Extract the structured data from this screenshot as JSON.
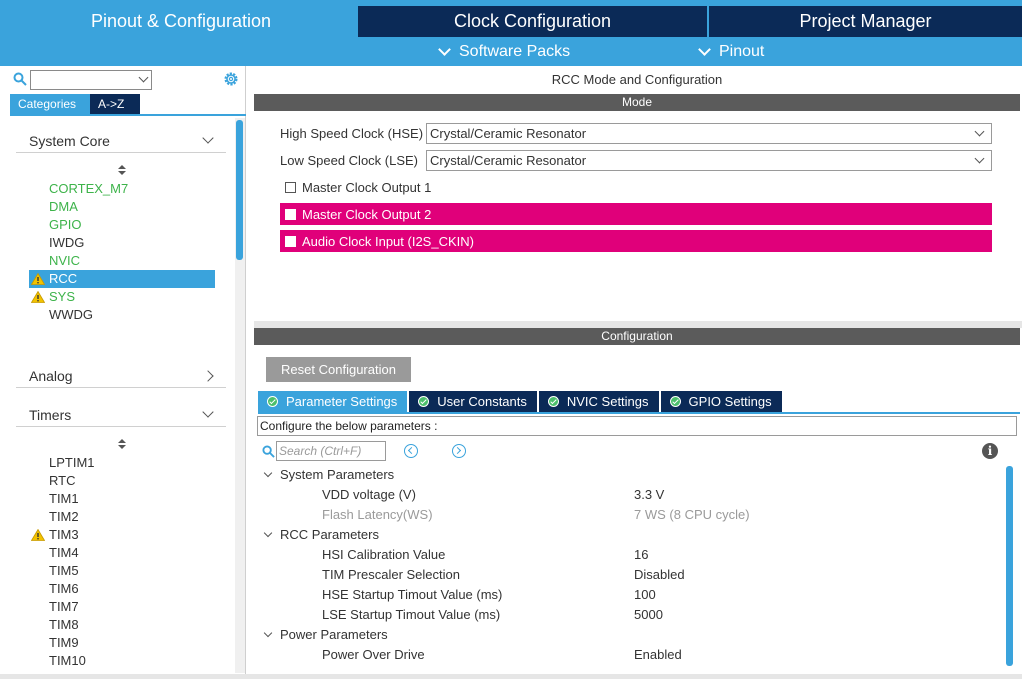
{
  "nav": {
    "tabs": {
      "pinout": "Pinout & Configuration",
      "clock": "Clock Configuration",
      "project": "Project Manager"
    },
    "subtabs": {
      "software_packs": "Software Packs",
      "pinout": "Pinout"
    }
  },
  "sidebar": {
    "search": {
      "value": ""
    },
    "tabs": {
      "categories": "Categories",
      "az": "A->Z"
    },
    "groups": {
      "system_core": "System Core",
      "analog": "Analog",
      "timers": "Timers"
    },
    "system_core_items": [
      {
        "label": "CORTEX_M7",
        "status": "configured"
      },
      {
        "label": "DMA",
        "status": "configured"
      },
      {
        "label": "GPIO",
        "status": "configured"
      },
      {
        "label": "IWDG",
        "status": "none"
      },
      {
        "label": "NVIC",
        "status": "configured"
      },
      {
        "label": "RCC",
        "status": "warning-selected"
      },
      {
        "label": "SYS",
        "status": "warning"
      },
      {
        "label": "WWDG",
        "status": "none"
      }
    ],
    "timers_items": [
      {
        "label": "LPTIM1",
        "status": "none"
      },
      {
        "label": "RTC",
        "status": "none"
      },
      {
        "label": "TIM1",
        "status": "none"
      },
      {
        "label": "TIM2",
        "status": "none"
      },
      {
        "label": "TIM3",
        "status": "warning"
      },
      {
        "label": "TIM4",
        "status": "none"
      },
      {
        "label": "TIM5",
        "status": "none"
      },
      {
        "label": "TIM6",
        "status": "none"
      },
      {
        "label": "TIM7",
        "status": "none"
      },
      {
        "label": "TIM8",
        "status": "none"
      },
      {
        "label": "TIM9",
        "status": "none"
      },
      {
        "label": "TIM10",
        "status": "none"
      }
    ]
  },
  "main": {
    "title": "RCC Mode and Configuration",
    "mode": {
      "header": "Mode",
      "hse_label": "High Speed Clock (HSE)",
      "hse_value": "Crystal/Ceramic Resonator",
      "lse_label": "Low Speed Clock (LSE)",
      "lse_value": "Crystal/Ceramic Resonator",
      "mco1": "Master Clock Output 1",
      "mco2": "Master Clock Output 2",
      "audio": "Audio Clock Input (I2S_CKIN)"
    },
    "config": {
      "header": "Configuration",
      "reset_button": "Reset Configuration",
      "tabs": [
        "Parameter Settings",
        "User Constants",
        "NVIC Settings",
        "GPIO Settings"
      ],
      "description": "Configure the below parameters :",
      "search_placeholder": "Search (Ctrl+F)",
      "groups": {
        "system": "System Parameters",
        "rcc": "RCC Parameters",
        "power": "Power Parameters"
      },
      "params": {
        "vdd": {
          "name": "VDD voltage (V)",
          "value": "3.3 V"
        },
        "flash": {
          "name": "Flash Latency(WS)",
          "value": "7 WS (8 CPU cycle)"
        },
        "hsi": {
          "name": "HSI Calibration Value",
          "value": "16"
        },
        "tim": {
          "name": "TIM Prescaler Selection",
          "value": "Disabled"
        },
        "hse_timeout": {
          "name": "HSE Startup Timout Value (ms)",
          "value": "100"
        },
        "lse_timeout": {
          "name": "LSE Startup Timout Value (ms)",
          "value": "5000"
        },
        "pod": {
          "name": "Power Over Drive",
          "value": "Enabled"
        }
      }
    }
  },
  "colors": {
    "accent": "#3aa3dc",
    "navy": "#0b2a57",
    "configured_green": "#3db34a",
    "conflict_pink": "#e0007a",
    "warning_yellow": "#f2c200"
  },
  "icons": {
    "search": "search-icon",
    "gear": "gear-icon",
    "warning": "warning-icon",
    "check": "check-circle-icon",
    "info": "info-icon"
  }
}
